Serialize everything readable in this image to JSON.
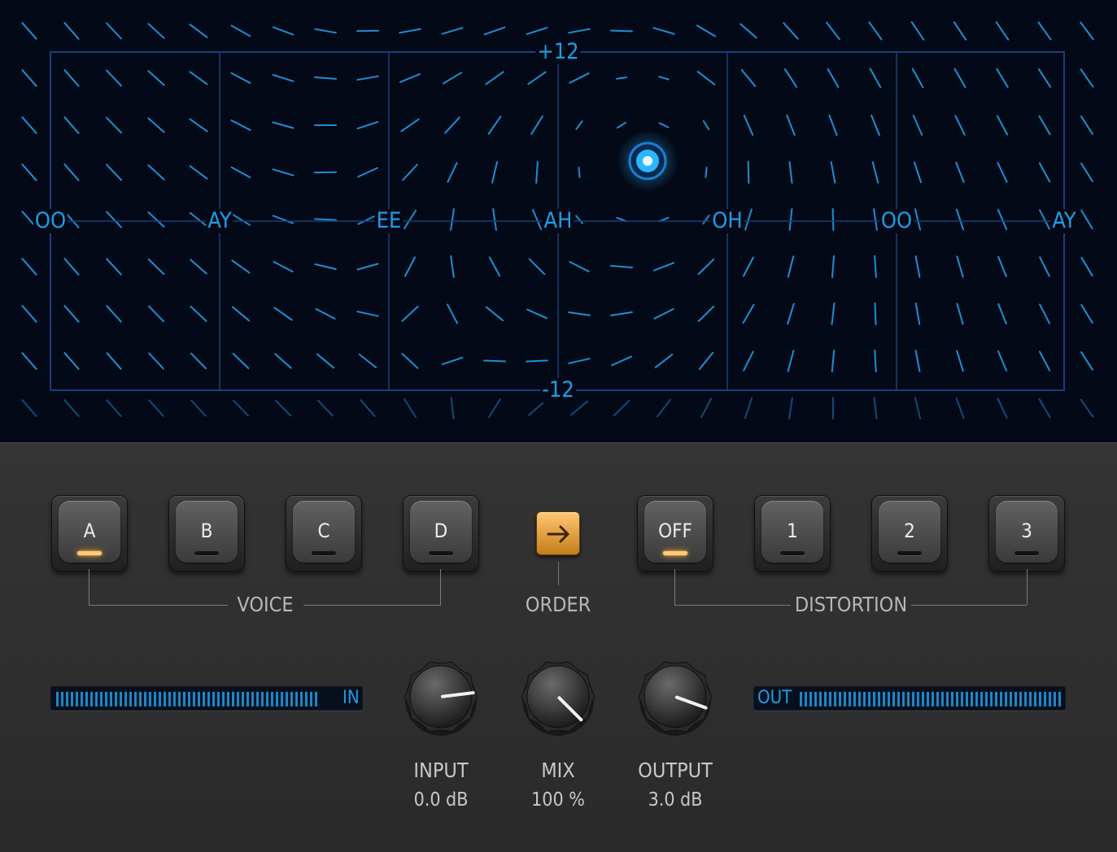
{
  "pad": {
    "top_label": "+12",
    "bottom_label": "-12",
    "vowels": [
      "OO",
      "AY",
      "EE",
      "AH",
      "OH",
      "OO",
      "AY"
    ],
    "grid_color": "#1a3f7a",
    "accent": "#1f9ee6",
    "cursor_color": "#2bb7ff"
  },
  "voice": {
    "label": "VOICE",
    "buttons": [
      {
        "label": "A",
        "active": true
      },
      {
        "label": "B",
        "active": false
      },
      {
        "label": "C",
        "active": false
      },
      {
        "label": "D",
        "active": false
      }
    ]
  },
  "order": {
    "label": "ORDER",
    "icon": "arrow-right-icon",
    "color": "#f0a43c"
  },
  "distortion": {
    "label": "DISTORTION",
    "buttons": [
      {
        "label": "OFF",
        "active": true
      },
      {
        "label": "1",
        "active": false
      },
      {
        "label": "2",
        "active": false
      },
      {
        "label": "3",
        "active": false
      }
    ]
  },
  "meters": {
    "in_label": "IN",
    "out_label": "OUT",
    "color": "#1f9ee6"
  },
  "knobs": {
    "input": {
      "label": "INPUT",
      "value": "0.0 dB"
    },
    "mix": {
      "label": "MIX",
      "value": "100 %"
    },
    "output": {
      "label": "OUTPUT",
      "value": "3.0 dB"
    }
  },
  "led_on_color": "#ffb347"
}
